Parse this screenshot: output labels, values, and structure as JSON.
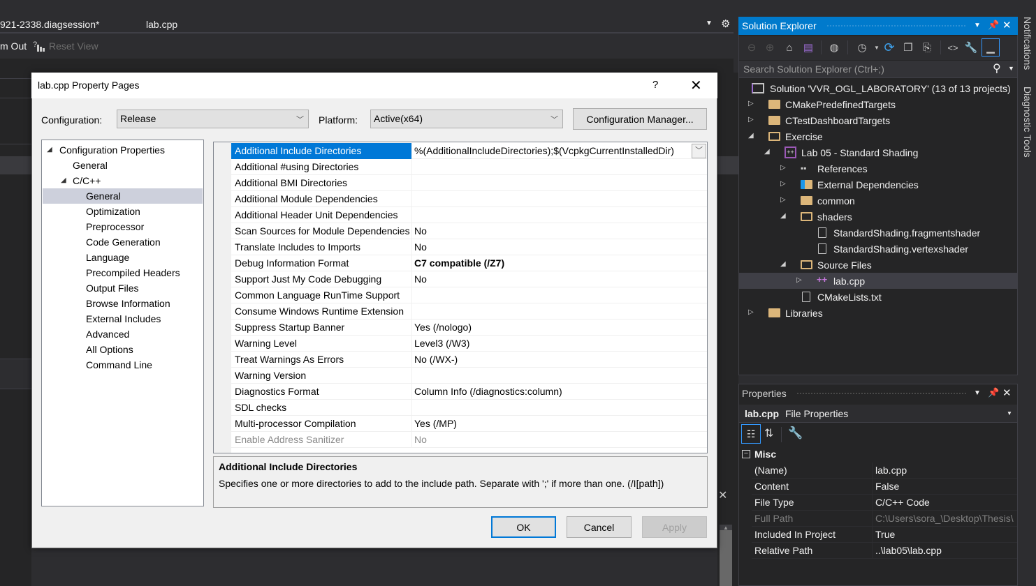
{
  "ide": {
    "doc_tabs": [
      "921-2338.diagsession*",
      "lab.cpp"
    ],
    "toolbar": {
      "zoom_out": "m Out",
      "reset_view": "Reset View"
    },
    "side_tabs": [
      "Notifications",
      "Diagnostic Tools"
    ]
  },
  "solution_explorer": {
    "title": "Solution Explorer",
    "search_placeholder": "Search Solution Explorer (Ctrl+;)",
    "toolbar_icons": [
      "back-icon",
      "forward-icon",
      "home-icon",
      "switch-views-icon",
      "globe-icon",
      "pending-changes-icon",
      "sync-icon",
      "collapse-all-icon",
      "show-all-files-icon",
      "view-code-icon",
      "properties-icon",
      "preview-icon"
    ],
    "tree": [
      {
        "label": "Solution 'VVR_OGL_LABORATORY' (13 of 13 projects)",
        "level": 0,
        "icon": "solution",
        "expander": "none"
      },
      {
        "label": "CMakePredefinedTargets",
        "level": 1,
        "icon": "folder",
        "expander": "collapsed"
      },
      {
        "label": "CTestDashboardTargets",
        "level": 1,
        "icon": "folder",
        "expander": "collapsed"
      },
      {
        "label": "Exercise",
        "level": 1,
        "icon": "folder-open",
        "expander": "expanded"
      },
      {
        "label": "Lab 05 - Standard Shading",
        "level": 2,
        "icon": "cpp-project",
        "expander": "expanded"
      },
      {
        "label": "References",
        "level": 3,
        "icon": "references",
        "expander": "collapsed"
      },
      {
        "label": "External Dependencies",
        "level": 3,
        "icon": "ext-deps",
        "expander": "collapsed"
      },
      {
        "label": "common",
        "level": 3,
        "icon": "filter-folder",
        "expander": "collapsed"
      },
      {
        "label": "shaders",
        "level": 3,
        "icon": "filter-folder-open",
        "expander": "expanded"
      },
      {
        "label": "StandardShading.fragmentshader",
        "level": 4,
        "icon": "file",
        "expander": "none"
      },
      {
        "label": "StandardShading.vertexshader",
        "level": 4,
        "icon": "file",
        "expander": "none"
      },
      {
        "label": "Source Files",
        "level": 3,
        "icon": "filter-folder-open",
        "expander": "expanded"
      },
      {
        "label": "lab.cpp",
        "level": 4,
        "icon": "cpp-file",
        "expander": "collapsed",
        "selected": true
      },
      {
        "label": "CMakeLists.txt",
        "level": 3,
        "icon": "text-file",
        "expander": "none"
      },
      {
        "label": "Libraries",
        "level": 1,
        "icon": "folder",
        "expander": "collapsed"
      }
    ]
  },
  "properties": {
    "title": "Properties",
    "object_name": "lab.cpp",
    "object_type": "File Properties",
    "category": "Misc",
    "rows": [
      {
        "name": "(Name)",
        "value": "lab.cpp"
      },
      {
        "name": "Content",
        "value": "False"
      },
      {
        "name": "File Type",
        "value": "C/C++ Code"
      },
      {
        "name": "Full Path",
        "value": "C:\\Users\\sora_\\Desktop\\Thesis\\",
        "dim": true
      },
      {
        "name": "Included In Project",
        "value": "True"
      },
      {
        "name": "Relative Path",
        "value": "..\\lab05\\lab.cpp"
      }
    ]
  },
  "dialog": {
    "title": "lab.cpp Property Pages",
    "help": "?",
    "configuration_label": "Configuration:",
    "configuration_value": "Release",
    "platform_label": "Platform:",
    "platform_value": "Active(x64)",
    "config_manager": "Configuration Manager...",
    "nav": [
      {
        "label": "Configuration Properties",
        "level": 0,
        "expander": "expanded"
      },
      {
        "label": "General",
        "level": 1
      },
      {
        "label": "C/C++",
        "level": 1,
        "expander": "expanded"
      },
      {
        "label": "General",
        "level": 2,
        "selected": true
      },
      {
        "label": "Optimization",
        "level": 2
      },
      {
        "label": "Preprocessor",
        "level": 2
      },
      {
        "label": "Code Generation",
        "level": 2
      },
      {
        "label": "Language",
        "level": 2
      },
      {
        "label": "Precompiled Headers",
        "level": 2
      },
      {
        "label": "Output Files",
        "level": 2
      },
      {
        "label": "Browse Information",
        "level": 2
      },
      {
        "label": "External Includes",
        "level": 2
      },
      {
        "label": "Advanced",
        "level": 2
      },
      {
        "label": "All Options",
        "level": 2
      },
      {
        "label": "Command Line",
        "level": 2
      }
    ],
    "grid": [
      {
        "name": "Additional Include Directories",
        "value": "%(AdditionalIncludeDirectories);$(VcpkgCurrentInstalledDir)",
        "selected": true
      },
      {
        "name": "Additional #using Directories",
        "value": ""
      },
      {
        "name": "Additional BMI Directories",
        "value": ""
      },
      {
        "name": "Additional Module Dependencies",
        "value": ""
      },
      {
        "name": "Additional Header Unit Dependencies",
        "value": ""
      },
      {
        "name": "Scan Sources for Module Dependencies",
        "value": "No"
      },
      {
        "name": "Translate Includes to Imports",
        "value": "No"
      },
      {
        "name": "Debug Information Format",
        "value": "C7 compatible (/Z7)",
        "bold": true
      },
      {
        "name": "Support Just My Code Debugging",
        "value": "No"
      },
      {
        "name": "Common Language RunTime Support",
        "value": ""
      },
      {
        "name": "Consume Windows Runtime Extension",
        "value": ""
      },
      {
        "name": "Suppress Startup Banner",
        "value": "Yes (/nologo)"
      },
      {
        "name": "Warning Level",
        "value": "Level3 (/W3)"
      },
      {
        "name": "Treat Warnings As Errors",
        "value": "No (/WX-)"
      },
      {
        "name": "Warning Version",
        "value": ""
      },
      {
        "name": "Diagnostics Format",
        "value": "Column Info (/diagnostics:column)"
      },
      {
        "name": "SDL checks",
        "value": ""
      },
      {
        "name": "Multi-processor Compilation",
        "value": "Yes (/MP)"
      },
      {
        "name": "Enable Address Sanitizer",
        "value": "No",
        "dim": true
      }
    ],
    "description_title": "Additional Include Directories",
    "description_text": "Specifies one or more directories to add to the include path. Separate with ';' if more than one. (/I[path])",
    "buttons": {
      "ok": "OK",
      "cancel": "Cancel",
      "apply": "Apply"
    }
  }
}
